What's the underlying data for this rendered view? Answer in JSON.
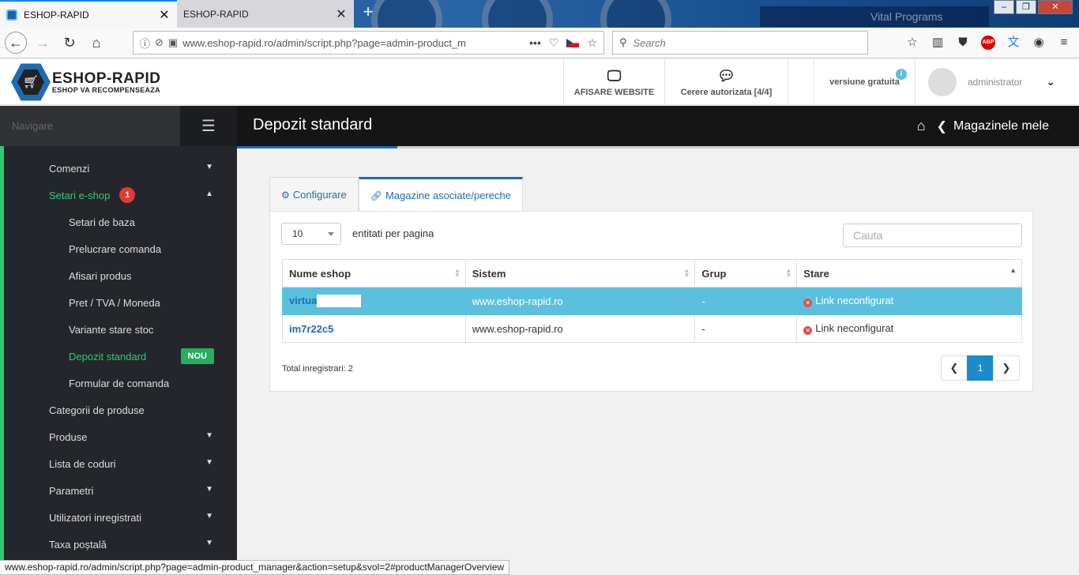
{
  "browser": {
    "tabs": [
      {
        "title": "ESHOP-RAPID",
        "active": true
      },
      {
        "title": "ESHOP-RAPID",
        "active": false
      }
    ],
    "url": "www.eshop-rapid.ro/admin/script.php?page=admin-product_m",
    "search_placeholder": "Search",
    "vital_text": "Vital Programs",
    "status_url": "www.eshop-rapid.ro/admin/script.php?page=admin-product_manager&action=setup&svol=2#productManagerOverview"
  },
  "header": {
    "logo_title": "ESHOP-RAPID",
    "logo_subtitle": "ESHOP VA RECOMPENSEAZA",
    "website_label": "AFISARE WEBSITE",
    "cerere_label": "Cerere autorizata [4/4]",
    "versiune_label": "versiune gratuita",
    "user_name": "administrator"
  },
  "sidebar": {
    "nav_label": "Navigare",
    "items": [
      {
        "label": "Comenzi",
        "level": 0,
        "chevron": "down"
      },
      {
        "label": "Setari e-shop",
        "level": 0,
        "chevron": "up",
        "badge": "1",
        "active": true
      },
      {
        "label": "Setari de baza",
        "level": 1
      },
      {
        "label": "Prelucrare comanda",
        "level": 1
      },
      {
        "label": "Afisari produs",
        "level": 1
      },
      {
        "label": "Pret / TVA / Moneda",
        "level": 1
      },
      {
        "label": "Variante stare stoc",
        "level": 1
      },
      {
        "label": "Depozit standard",
        "level": 1,
        "active": true,
        "tag": "NOU"
      },
      {
        "label": "Formular de comanda",
        "level": 1
      },
      {
        "label": "Categorii de produse",
        "level": 0
      },
      {
        "label": "Produse",
        "level": 0,
        "chevron": "down"
      },
      {
        "label": "Lista de coduri",
        "level": 0,
        "chevron": "down"
      },
      {
        "label": "Parametri",
        "level": 0,
        "chevron": "down"
      },
      {
        "label": "Utilizatori inregistrati",
        "level": 0,
        "chevron": "down"
      },
      {
        "label": "Taxa poștală",
        "level": 0,
        "chevron": "down"
      }
    ]
  },
  "page": {
    "title": "Depozit standard",
    "breadcrumb": "Magazinele mele",
    "tabs": [
      {
        "label": "Configurare",
        "active": false
      },
      {
        "label": "Magazine asociate/pereche",
        "active": true
      }
    ],
    "per_page_value": "10",
    "per_page_label": "entitati per pagina",
    "search_placeholder": "Cauta",
    "columns": [
      "Nume eshop",
      "Sistem",
      "Grup",
      "Stare"
    ],
    "rows": [
      {
        "name": "virtual",
        "system": "www.eshop-rapid.ro",
        "group": "-",
        "status": "Link neconfigurat",
        "selected": true
      },
      {
        "name": "im7r22c5",
        "system": "www.eshop-rapid.ro",
        "group": "-",
        "status": "Link neconfigurat",
        "selected": false
      }
    ],
    "total_label": "Total inregistrari: 2",
    "current_page": "1"
  },
  "colors": {
    "accent": "#1d6bb5",
    "sidebar_bg": "#24262b",
    "sidebar_active": "#2ecc71",
    "selected_row": "#5bc0de",
    "error": "#d9534f"
  }
}
